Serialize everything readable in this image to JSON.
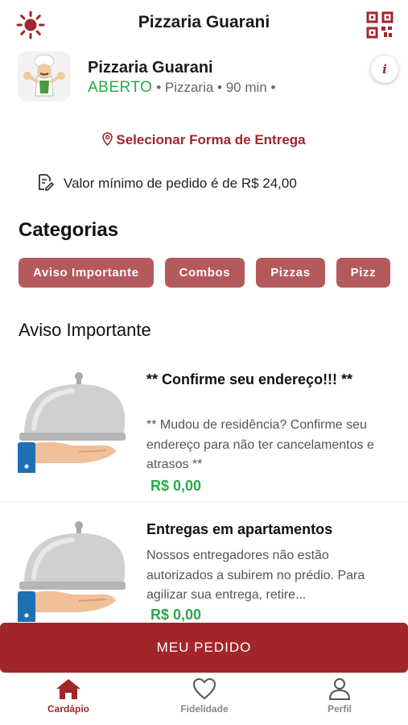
{
  "header": {
    "title": "Pizzaria Guarani",
    "left_icon": "sun-icon",
    "right_icon": "qr-code-icon"
  },
  "store": {
    "name": "Pizzaria Guarani",
    "status": "ABERTO",
    "meta": "• Pizzaria • 90 min •",
    "info_icon": "i"
  },
  "delivery": {
    "label": "Selecionar Forma de Entrega"
  },
  "min_order": {
    "text": "Valor mínimo de pedido é de R$ 24,00"
  },
  "categories": {
    "title": "Categorias",
    "items": [
      "Aviso Importante",
      "Combos",
      "Pizzas",
      "Pizz"
    ]
  },
  "section": {
    "title": "Aviso Importante"
  },
  "products": [
    {
      "name": "** Confirme seu endereço!!! **",
      "description": "** Mudou de residência? Confirme seu endereço para não ter cancelamentos e atrasos  **",
      "price": "R$ 0,00"
    },
    {
      "name": "Entregas em apartamentos",
      "description": "Nossos entregadores não estão autorizados a subirem no prédio. Para agilizar sua entrega, retire...",
      "price": "R$ 0,00"
    }
  ],
  "cta": {
    "label": "MEU PEDIDO"
  },
  "tabs": [
    {
      "label": "Cardápio",
      "icon": "home-icon",
      "active": true
    },
    {
      "label": "Fidelidade",
      "icon": "heart-icon",
      "active": false
    },
    {
      "label": "Perfil",
      "icon": "user-icon",
      "active": false
    }
  ],
  "colors": {
    "brand": "#a0262a",
    "chip": "#b55a5c",
    "open": "#2aa84a",
    "price": "#2aa84a"
  }
}
